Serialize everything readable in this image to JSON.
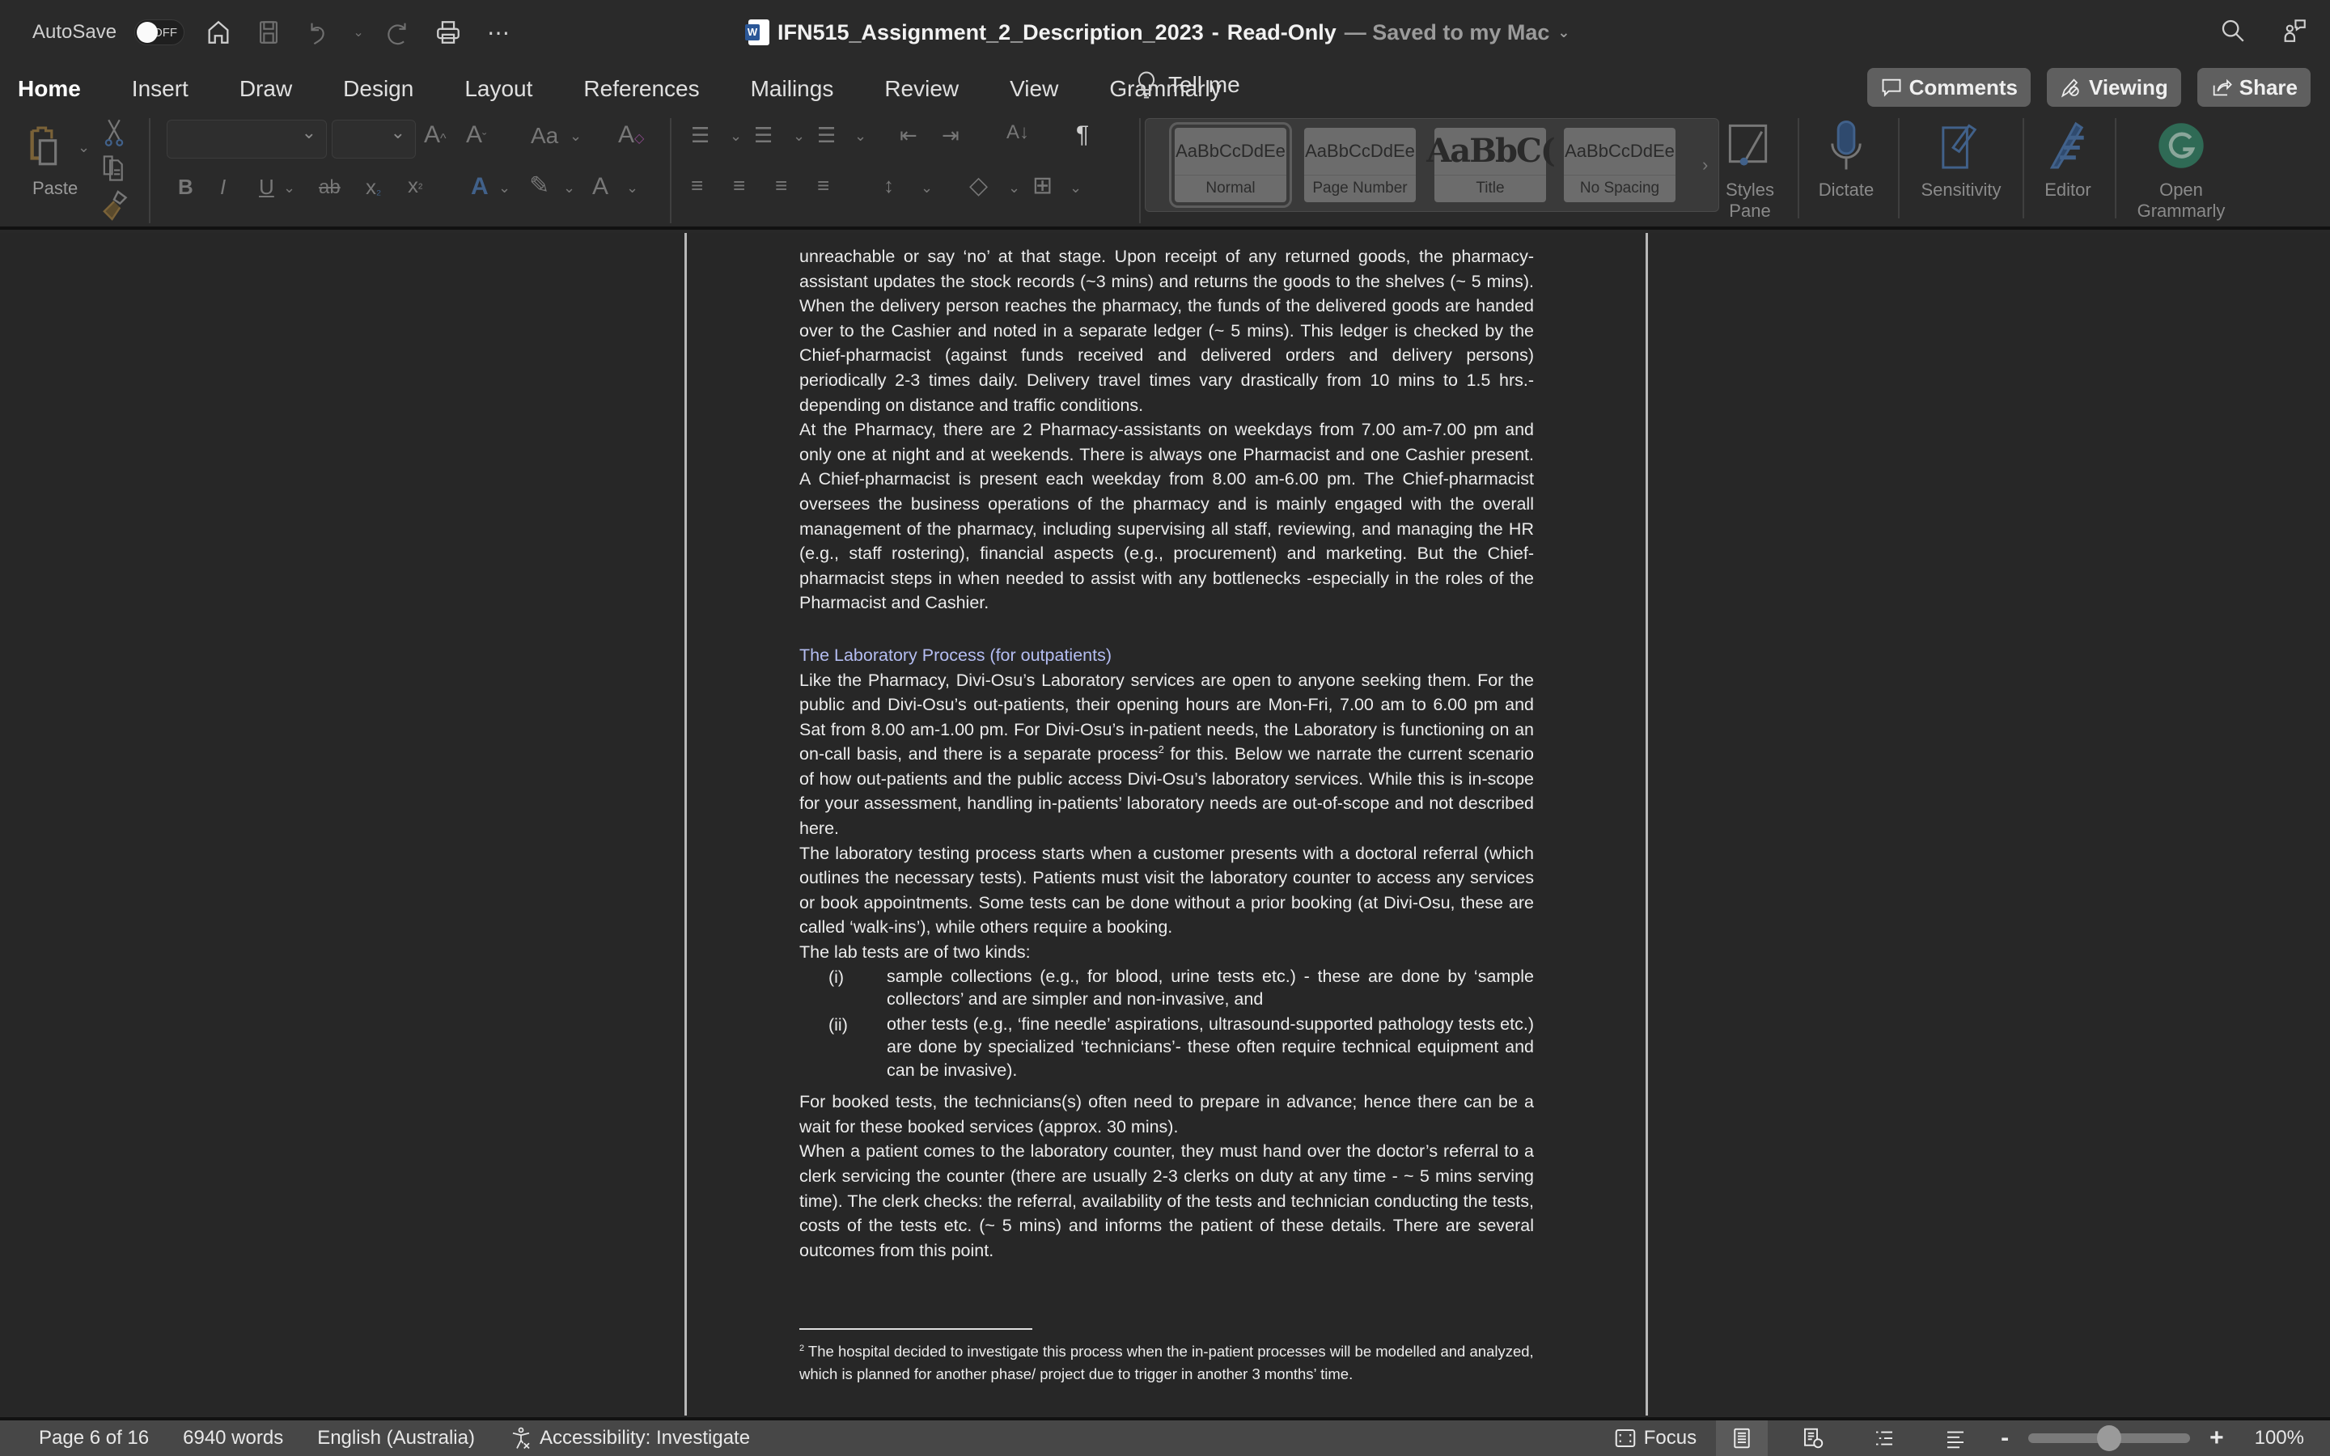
{
  "titlebar": {
    "autosave_label": "AutoSave",
    "autosave_state": "OFF",
    "document_name": "IFN515_Assignment_2_Description_2023",
    "separator": "-",
    "mode": "Read-Only",
    "saved_status": "— Saved to my Mac",
    "icons": [
      "home-icon",
      "save-icon",
      "undo-icon",
      "redo-icon",
      "print-icon",
      "more-icon",
      "search-icon",
      "share-people-icon"
    ]
  },
  "ribbon": {
    "tabs": [
      {
        "label": "Home",
        "active": true
      },
      {
        "label": "Insert"
      },
      {
        "label": "Draw"
      },
      {
        "label": "Design"
      },
      {
        "label": "Layout"
      },
      {
        "label": "References"
      },
      {
        "label": "Mailings"
      },
      {
        "label": "Review"
      },
      {
        "label": "View"
      },
      {
        "label": "Grammarly"
      }
    ],
    "tell_me": "Tell me",
    "buttons": {
      "comments": "Comments",
      "viewing": "Viewing",
      "share": "Share"
    },
    "clipboard": {
      "paste_label": "Paste"
    },
    "font": {
      "name_value": "",
      "size_value": ""
    },
    "styles": [
      {
        "sample": "AaBbCcDdEe",
        "label": "Normal",
        "selected": true
      },
      {
        "sample": "AaBbCcDdEe",
        "label": "Page Number"
      },
      {
        "sample": "AaBbC(",
        "label": "Title"
      },
      {
        "sample": "AaBbCcDdEe",
        "label": "No Spacing"
      }
    ],
    "tools": {
      "styles_pane": "Styles Pane",
      "styles_pane_l1": "Styles",
      "styles_pane_l2": "Pane",
      "dictate": "Dictate",
      "sensitivity": "Sensitivity",
      "editor": "Editor",
      "open_grammarly_l1": "Open",
      "open_grammarly_l2": "Grammarly"
    },
    "colors": {
      "grammarly": "#2f6a55",
      "accent_blue": "#41618a",
      "paste_brown": "#7a6238"
    }
  },
  "document": {
    "paragraphs": [
      "unreachable or say ‘no’ at that stage. Upon receipt of any returned goods, the pharmacy-assistant updates the stock records (~3 mins) and returns the goods to the shelves (~ 5 mins). When the delivery person reaches the pharmacy, the funds of the delivered goods are handed over to the Cashier and noted in a separate ledger (~ 5 mins). This ledger is checked by the Chief-pharmacist (against funds received and delivered orders and delivery persons) periodically 2-3 times daily. Delivery travel times vary drastically from 10 mins to 1.5 hrs.- depending on distance and traffic conditions.",
      "At the Pharmacy, there are 2 Pharmacy-assistants on weekdays from 7.00 am-7.00 pm and only one at night and at weekends. There is always one Pharmacist and one Cashier present. A Chief-pharmacist is present each weekday from 8.00 am-6.00 pm. The Chief-pharmacist oversees the business operations of the pharmacy and is mainly engaged with the overall management of the pharmacy, including supervising all staff, reviewing, and managing the HR (e.g., staff rostering), financial aspects (e.g., procurement) and marketing. But the Chief-pharmacist steps in when needed to assist with any bottlenecks -especially in the roles of the Pharmacist and Cashier."
    ],
    "heading": "The Laboratory Process (for outpatients)",
    "lab_para1_a": "Like the Pharmacy, Divi-Osu’s Laboratory services are open to anyone seeking them. For the public and Divi-Osu’s out-patients, their opening hours are Mon-Fri, 7.00 am to 6.00 pm and Sat from 8.00 am-1.00 pm. For Divi-Osu’s in-patient needs, the Laboratory is functioning on an on-call basis, and there is a separate process",
    "lab_para1_sup": "2",
    "lab_para1_b": " for this. Below we narrate the current scenario of how out-patients and the public access Divi-Osu’s laboratory services. While this is in-scope for your assessment, handling in-patients’ laboratory needs are out-of-scope and not described here.",
    "lab_para2": "The laboratory testing process starts when a customer presents with a doctoral referral (which outlines the necessary tests). Patients must visit the laboratory counter to access any services or book appointments. Some tests can be done without a prior booking (at Divi-Osu, these are called ‘walk-ins’), while others require a booking.",
    "lab_para3": "The lab tests are of two kinds:",
    "list": [
      {
        "num": "(i)",
        "text": "sample collections (e.g., for blood, urine tests etc.) - these are done by ‘sample collectors’ and are simpler and non-invasive, and"
      },
      {
        "num": "(ii)",
        "text": "other tests (e.g., ‘fine needle’ aspirations, ultrasound-supported pathology tests etc.) are done by specialized ‘technicians’- these often require technical equipment and can be invasive)."
      }
    ],
    "lab_para4": "For booked tests, the technicians(s) often need to prepare in advance; hence there can be a wait for these booked services (approx. 30 mins).",
    "lab_para5": "When a patient comes to the laboratory counter, they must hand over the doctor’s referral to a clerk servicing the counter (there are usually 2-3 clerks on duty at any time - ~ 5 mins serving time). The clerk checks: the referral, availability of the tests and technician conducting the tests, costs of the tests etc. (~ 5 mins) and informs the patient of these details. There are several outcomes from this point.",
    "footnote_num": "2",
    "footnote_text": " The hospital decided to investigate this process when the in-patient processes will be modelled and analyzed, which is planned for another phase/ project due to trigger in another 3 months’ time.",
    "heading_color": "#b4bdf2"
  },
  "statusbar": {
    "page": "Page 6 of 16",
    "words": "6940 words",
    "language": "English (Australia)",
    "accessibility": "Accessibility: Investigate",
    "focus": "Focus",
    "zoom_minus": "-",
    "zoom_plus": "+",
    "zoom_level": "100%",
    "zoom_percent": 100
  }
}
